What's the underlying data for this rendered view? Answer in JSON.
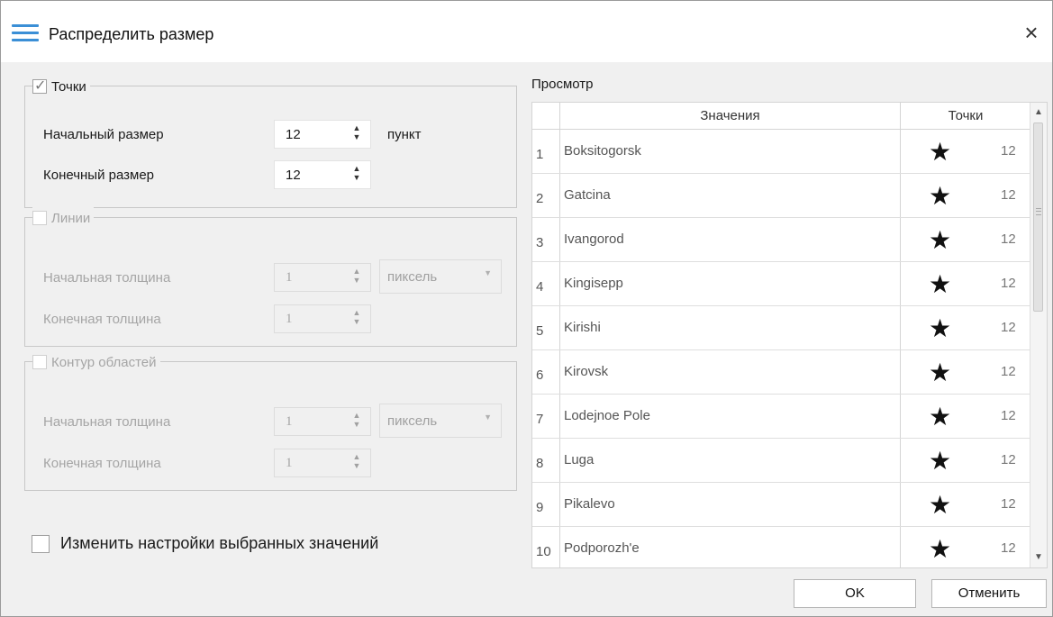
{
  "window": {
    "title": "Распределить размер",
    "close_glyph": "×"
  },
  "points": {
    "checked": true,
    "label": "Точки",
    "start_label": "Начальный размер",
    "start_value": "12",
    "start_unit": "пункт",
    "end_label": "Конечный размер",
    "end_value": "12"
  },
  "lines": {
    "checked": false,
    "label": "Линии",
    "start_label": "Начальная толщина",
    "start_value": "1",
    "unit": "пиксель",
    "end_label": "Конечная толщина",
    "end_value": "1"
  },
  "area_outline": {
    "checked": false,
    "label": "Контур областей",
    "start_label": "Начальная толщина",
    "start_value": "1",
    "unit": "пиксель",
    "end_label": "Конечная толщина",
    "end_value": "1"
  },
  "apply_selected": {
    "checked": false,
    "label": "Изменить настройки выбранных значений"
  },
  "preview": {
    "label": "Просмотр",
    "columns": {
      "values": "Значения",
      "points": "Точки"
    },
    "symbol": "★",
    "rows": [
      {
        "index": "1",
        "value": "Boksitogorsk",
        "size": "12"
      },
      {
        "index": "2",
        "value": "Gatcina",
        "size": "12"
      },
      {
        "index": "3",
        "value": "Ivangorod",
        "size": "12"
      },
      {
        "index": "4",
        "value": "Kingisepp",
        "size": "12"
      },
      {
        "index": "5",
        "value": "Kirishi",
        "size": "12"
      },
      {
        "index": "6",
        "value": "Kirovsk",
        "size": "12"
      },
      {
        "index": "7",
        "value": "Lodejnoe Pole",
        "size": "12"
      },
      {
        "index": "8",
        "value": "Luga",
        "size": "12"
      },
      {
        "index": "9",
        "value": "Pikalevo",
        "size": "12"
      },
      {
        "index": "10",
        "value": "Podporozh'e",
        "size": "12"
      }
    ]
  },
  "buttons": {
    "ok": "OK",
    "cancel": "Отменить"
  },
  "icons": {
    "menu": "hamburger-icon",
    "close": "close-icon",
    "checkmark": "checkmark-icon",
    "star": "star-icon",
    "spin_up_down": "spin-arrows-icon",
    "dropdown": "chevron-down-icon"
  },
  "colors": {
    "accent": "#3b8fd6",
    "dialog_bg": "#f0f0f0",
    "disabled_text": "#a5a5a5"
  }
}
